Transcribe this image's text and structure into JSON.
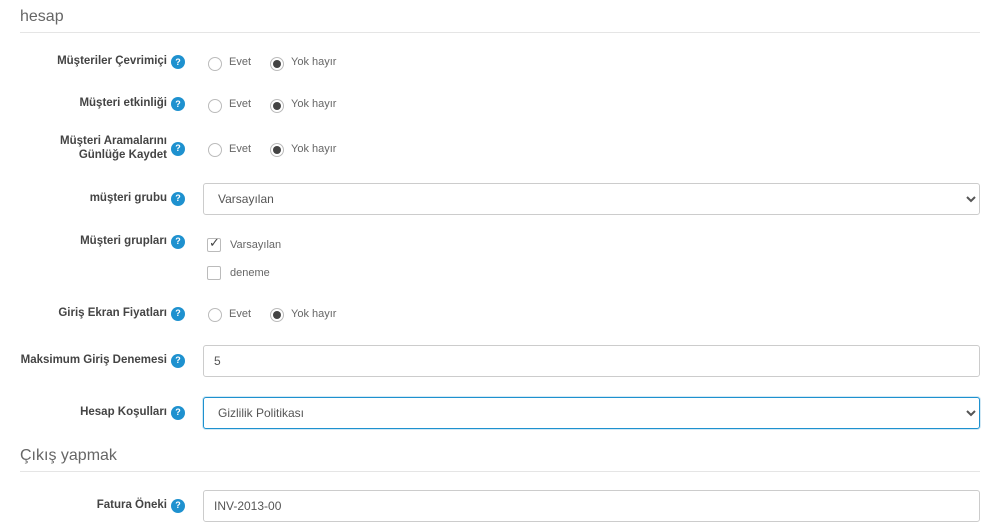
{
  "section1": {
    "title": "hesap"
  },
  "section2": {
    "title": "Çıkış yapmak"
  },
  "common": {
    "yes": "Evet",
    "no": "Yok hayır"
  },
  "fields": {
    "customersOnline": {
      "label": "Müşteriler Çevrimiçi",
      "value": "no"
    },
    "customerActivity": {
      "label": "Müşteri etkinliği",
      "value": "no"
    },
    "logCustomerSearches": {
      "label": "Müşteri Aramalarını Günlüğe Kaydet",
      "value": "no"
    },
    "customerGroup": {
      "label": "müşteri grubu",
      "selected": "Varsayılan"
    },
    "customerGroups": {
      "label": "Müşteri grupları",
      "options": [
        {
          "label": "Varsayılan",
          "checked": true
        },
        {
          "label": "deneme",
          "checked": false
        }
      ]
    },
    "loginScreenPrices": {
      "label": "Giriş Ekran Fiyatları",
      "value": "no"
    },
    "maxLoginAttempts": {
      "label": "Maksimum Giriş Denemesi",
      "value": "5"
    },
    "accountTerms": {
      "label": "Hesap Koşulları",
      "selected": "Gizlilik Politikası"
    },
    "invoicePrefix": {
      "label": "Fatura Öneki",
      "value": "INV-2013-00"
    }
  }
}
